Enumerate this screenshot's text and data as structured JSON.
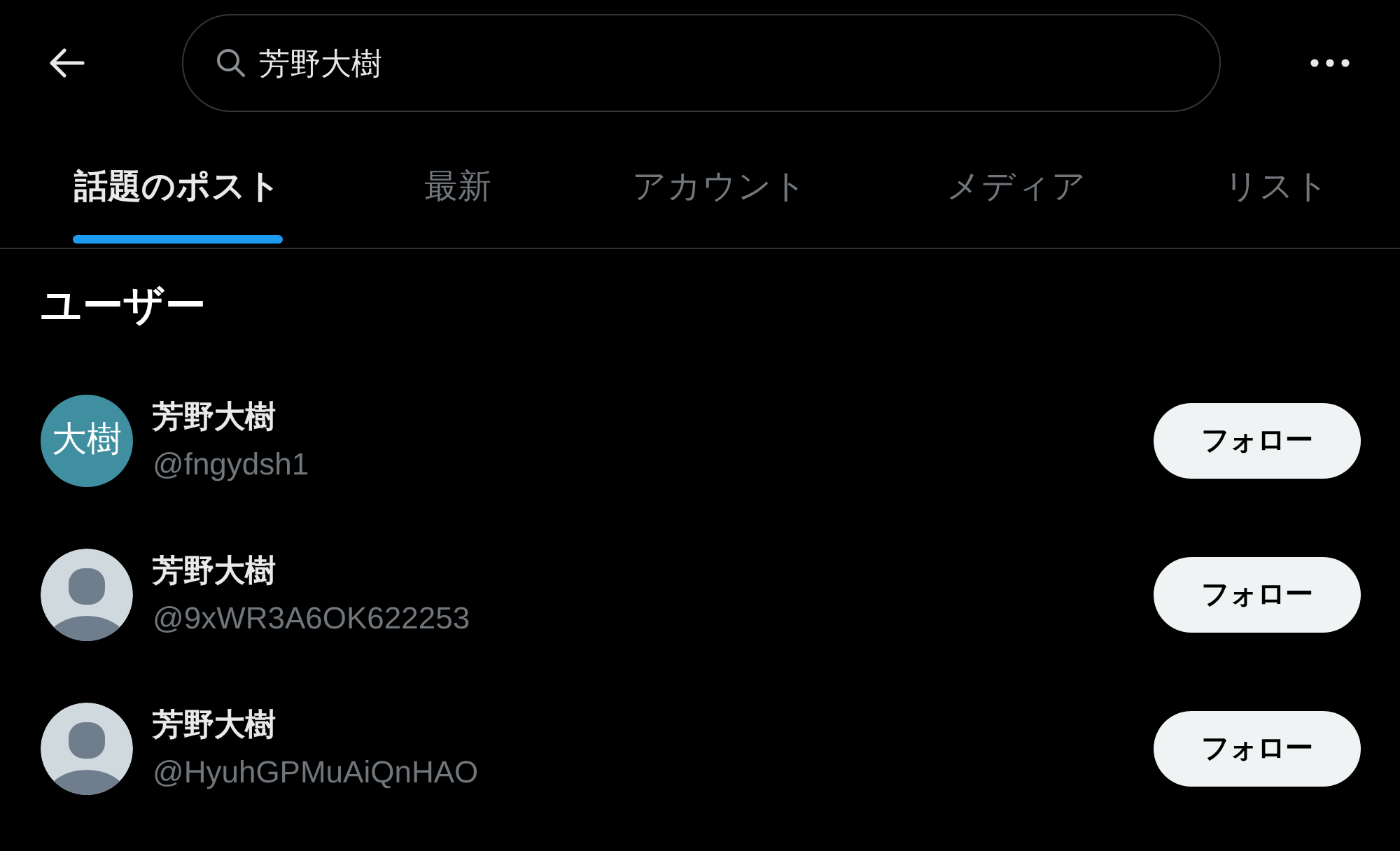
{
  "search": {
    "value": "芳野大樹"
  },
  "tabs": [
    {
      "label": "話題のポスト",
      "selected": true
    },
    {
      "label": "最新",
      "selected": false
    },
    {
      "label": "アカウント",
      "selected": false
    },
    {
      "label": "メディア",
      "selected": false
    },
    {
      "label": "リスト",
      "selected": false
    }
  ],
  "section_title": "ユーザー",
  "users": [
    {
      "name": "芳野大樹",
      "handle": "@fngydsh1",
      "avatar": {
        "kind": "initials",
        "text": "大樹",
        "color": "#3f8fa0"
      },
      "button": "フォロー"
    },
    {
      "name": "芳野大樹",
      "handle": "@9xWR3A6OK622253",
      "avatar": {
        "kind": "default"
      },
      "button": "フォロー"
    },
    {
      "name": "芳野大樹",
      "handle": "@HyuhGPMuAiQnHAO",
      "avatar": {
        "kind": "default"
      },
      "button": "フォロー"
    }
  ]
}
